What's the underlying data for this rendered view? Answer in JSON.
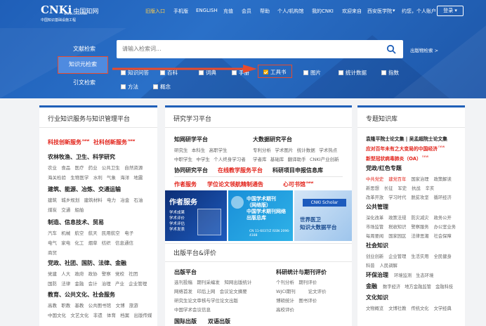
{
  "logo": {
    "brand": "CNKi",
    "cn": "中国知网",
    "url": "www.cnki.net",
    "sub": "中国知识基础设施工程"
  },
  "nav": {
    "links": [
      "旧版入口",
      "手机版",
      "ENGLISH",
      "充值",
      "会员",
      "帮助",
      "个人/机构馆",
      "我的CNKI",
      "欢迎来自",
      "西安医学院",
      "约您，个人账户"
    ],
    "login": "登录"
  },
  "search": {
    "tabs": [
      "文献检索",
      "知识元检索",
      "引文检索"
    ],
    "active_tab": "知识元检索",
    "placeholder": "请输入检索词...",
    "advanced": "出版物检索 >",
    "options": [
      "知识问答",
      "百科",
      "词典",
      "手册",
      "工具书",
      "图片",
      "统计数据",
      "指数",
      "方法",
      "概念"
    ],
    "checked": "工具书"
  },
  "colors": {
    "primary": "#1f5fb8",
    "highlight": "#e94b2c",
    "red_text": "#e2231a"
  },
  "left_panel": {
    "title": "行业知识服务与知识管理平台",
    "highlights": [
      "科技创新服务",
      "社科创新服务"
    ],
    "new_tag": "new",
    "sections": [
      {
        "heading": "农林牧渔、卫生、科学研究",
        "rows": [
          [
            "农业",
            "食品",
            "医疗",
            "药业",
            "公共卫生",
            "自然资源"
          ],
          [
            "海关检验",
            "生物医学",
            "水利",
            "气象",
            "海洋",
            "地震"
          ]
        ]
      },
      {
        "heading": "建筑、能源、冶炼、交通运输",
        "rows": [
          [
            "建筑",
            "城乡规划",
            "建筑材料",
            "电力",
            "冶金",
            "石油"
          ],
          [
            "煤炭",
            "交通",
            "船舶"
          ]
        ]
      },
      {
        "heading": "制造、信息技术、贸易",
        "rows": [
          [
            "汽车",
            "机械",
            "航空",
            "航天",
            "民用航空",
            "电子"
          ],
          [
            "电气",
            "家电",
            "化工",
            "烟草",
            "纺织",
            "信息通信"
          ],
          [
            "商贸"
          ]
        ]
      },
      {
        "heading": "党政、社团、国防、法律、金融",
        "rows": [
          [
            "党建",
            "人大",
            "政府",
            "政协",
            "警察",
            "党校",
            "社团"
          ],
          [
            "国防",
            "法律",
            "金融",
            "会计",
            "治理",
            "产业",
            "企业管理"
          ]
        ]
      },
      {
        "heading": "教育、公共文化、社会服务",
        "rows": [
          [
            "高教",
            "职教",
            "基教",
            "公共图书馆",
            "文博",
            "旅游"
          ],
          [
            "中国文化",
            "文艺文化",
            "非遗",
            "体育",
            "档案",
            "出版传媒"
          ]
        ]
      }
    ]
  },
  "mid_panel": {
    "title": "研究学习平台",
    "col1": {
      "heading": "知网研学平台",
      "rows": [
        [
          "研究生",
          "本科生",
          "高职学生"
        ],
        [
          "中职学生",
          "中学生",
          "个人终身学习者"
        ]
      ]
    },
    "col2": {
      "heading": "大数据研究平台",
      "rows": [
        [
          "专利分析",
          "学术图片",
          "统计数据",
          "学术热点"
        ],
        [
          "学者库",
          "基础库",
          "翻译助手",
          "CNKI产业创新"
        ]
      ]
    },
    "row2": [
      "协同研究平台",
      "在线教学服务平台",
      "科研项目申报信息库"
    ],
    "row3": [
      "作者服务",
      "学位论文领航精制通告",
      "心可书馆"
    ],
    "banner": {
      "b1_title": "作者服务",
      "b1_items": [
        "学术成果",
        "学术评价",
        "学术评估",
        "学术发表"
      ],
      "b2_lines": [
        "中国学术期刊",
        "（网络版）",
        "中国学术期刊网络",
        "出版总库"
      ],
      "b2_issn": "CN 11-6037/Z  ISSN 2096-4188",
      "b3_top": "CNKI Scholar",
      "b3_lines": [
        "世界医卫",
        "知识大数据平台"
      ]
    },
    "pub_title": "出版平台&评价",
    "pub": {
      "heading": "出版平台",
      "rows": [
        [
          "选刊投稿",
          "期刊采编发",
          "知网出版统计"
        ],
        [
          "网络首发",
          "印后上网",
          "会议论文摘要"
        ],
        [
          "研究生论文审核与学位论文出版"
        ],
        [
          "中国学术会议信息"
        ]
      ]
    },
    "eval": {
      "heading": "科研统计与期刊评价",
      "rows": [
        [
          "个刊分析",
          "期刊评价"
        ],
        [
          "WJCI期刊",
          "论文评价"
        ],
        [
          "博硕统计",
          "图书评价"
        ],
        [
          "高校评价"
        ]
      ]
    },
    "bottom": [
      "国际出版",
      "双语出版"
    ]
  },
  "right_panel": {
    "title": "专题知识库",
    "items": [
      {
        "type": "bold",
        "text": "袁隆平院士论文集 | 吴孟超院士论文集"
      },
      {
        "type": "red",
        "text": "应对百年未有之大变局的中国经济",
        "new": true
      },
      {
        "type": "red",
        "text": "新型冠状病毒肺炎（OA）",
        "new": true
      },
      {
        "type": "heading",
        "text": "党政/红色专题"
      },
      {
        "type": "row",
        "cells": [
          "中共党史",
          "建党百年",
          "国家治理",
          "政策解读"
        ]
      },
      {
        "type": "row",
        "cells": [
          "新思想",
          "长征",
          "军史",
          "抗战",
          "辛亥"
        ]
      },
      {
        "type": "row",
        "cells": [
          "改革开放",
          "学习时代",
          "脱贫攻坚",
          "循环经济"
        ]
      },
      {
        "type": "heading",
        "text": "公共管理"
      },
      {
        "type": "row",
        "cells": [
          "深化改革",
          "政策法规",
          "防灾减灾",
          "政务公开"
        ]
      },
      {
        "type": "row",
        "cells": [
          "市场监管",
          "税收知识",
          "警察服务",
          "办公室业务"
        ]
      },
      {
        "type": "row",
        "cells": [
          "每周要闻",
          "国家园区",
          "法律思潮",
          "社会保障"
        ]
      },
      {
        "type": "heading",
        "text": "社会知识"
      },
      {
        "type": "row",
        "cells": [
          "创业创新",
          "企业管理",
          "生活实用",
          "全民健身"
        ]
      },
      {
        "type": "row",
        "cells": [
          "科普",
          "人民调解"
        ]
      },
      {
        "type": "heading",
        "text": "环保治理",
        "cells": [
          "环境监测",
          "生态环境"
        ]
      },
      {
        "type": "heading",
        "text": "金融",
        "cells": [
          "数字经济",
          "地方金融监管",
          "金融科技"
        ]
      },
      {
        "type": "heading",
        "text": "文化知识"
      },
      {
        "type": "row",
        "cells": [
          "文物概览",
          "文博社教",
          "传统文化",
          "文学经典"
        ]
      }
    ]
  }
}
